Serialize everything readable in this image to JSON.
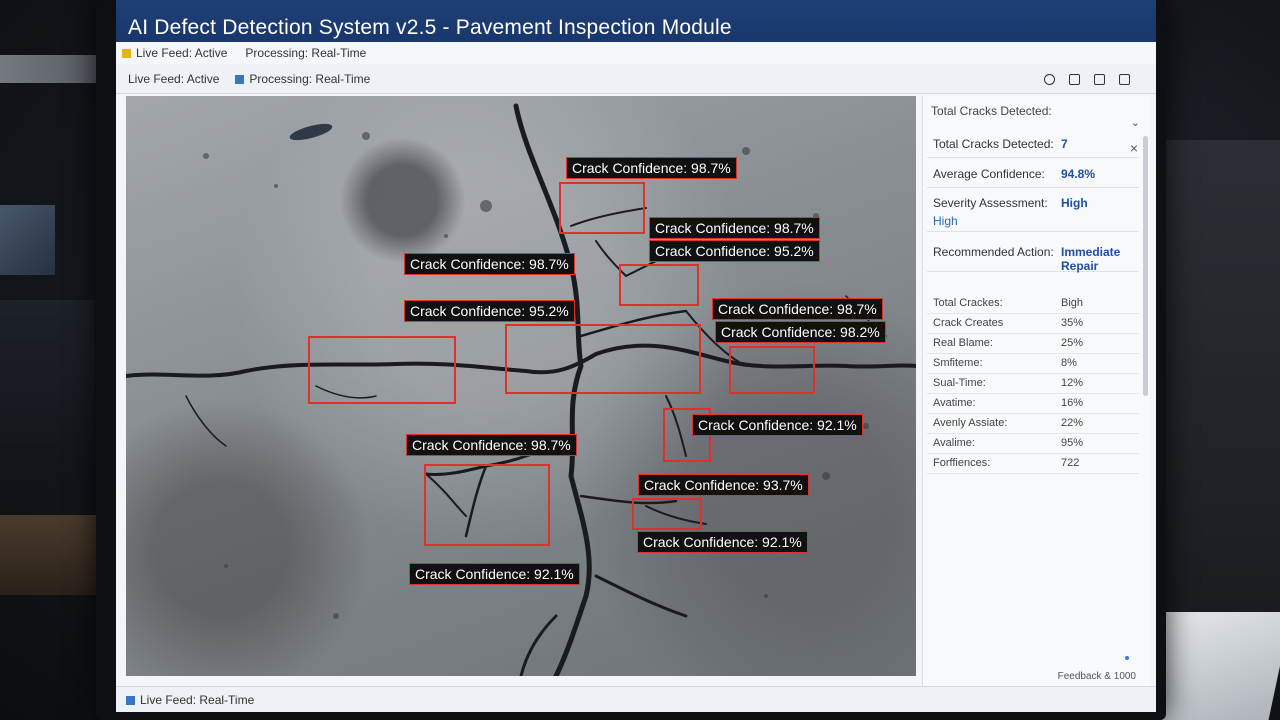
{
  "window": {
    "title": "AI Defect Detection System v2.5 - Pavement Inspection Module"
  },
  "status_top": {
    "feed": "Live Feed: Active",
    "processing": "Processing: Real-Time"
  },
  "status_sub": {
    "feed": "Live Feed: Active",
    "processing": "Processing: Real-Time"
  },
  "detections": [
    {
      "label": "Crack Confidence: 98.7%"
    },
    {
      "label": "Crack Confidence: 98.7%"
    },
    {
      "label": "Crack Confidence: 95.2%"
    },
    {
      "label": "Crack Confidence: 98.7%"
    },
    {
      "label": "Crack Confidence: 95.2%"
    },
    {
      "label": "Crack Confidence: 98.7%"
    },
    {
      "label": "Crack Confidence: 98.2%"
    },
    {
      "label": "Crack Confidence: 92.1%"
    },
    {
      "label": "Crack Confidence: 98.7%"
    },
    {
      "label": "Crack Confidence: 93.7%"
    },
    {
      "label": "Crack Confidence: 92.1%"
    },
    {
      "label": "Crack Confidence: 92.1%"
    }
  ],
  "panel": {
    "header": "Total Cracks Detected:",
    "summary": [
      {
        "key": "Total Cracks Detected:",
        "value": "7"
      },
      {
        "key": "Average Confidence:",
        "value": "94.8%"
      },
      {
        "key": "Severity Assessment:",
        "value": "High",
        "sub": "High"
      },
      {
        "key": "Recommended Action:",
        "value": "Immediate Repair"
      }
    ],
    "stats": [
      {
        "key": "Total Crackes:",
        "value": "Bigh"
      },
      {
        "key": "Crack Creates",
        "value": "35%"
      },
      {
        "key": "Real Blame:",
        "value": "25%"
      },
      {
        "key": "Smfiteme:",
        "value": "8%"
      },
      {
        "key": "Sual-Time:",
        "value": "12%"
      },
      {
        "key": "Avatime:",
        "value": "16%"
      },
      {
        "key": "Avenly Assiate:",
        "value": "22%"
      },
      {
        "key": "Avalime:",
        "value": "95%"
      },
      {
        "key": "Forffiences:",
        "value": "722"
      }
    ],
    "footer": "Feedback & 1000"
  },
  "bottom_bar": {
    "text": "Live Feed: Real-Time"
  },
  "colors": {
    "titlebar": "#1e3f78",
    "box": "#e0302c",
    "accent": "#1f4fa0",
    "live_indicator": "#e8b21f",
    "processing_indicator": "#3a74c4"
  }
}
